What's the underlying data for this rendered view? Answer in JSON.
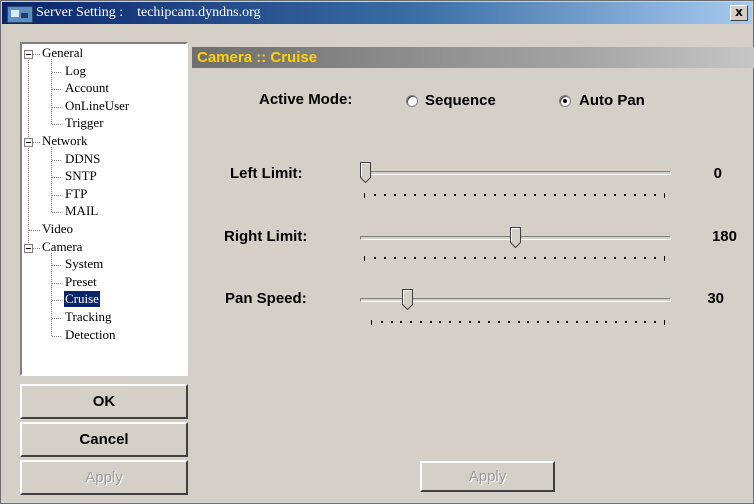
{
  "window": {
    "title_prefix": "Server Setting :",
    "title_host": "techipcam.dyndns.org",
    "close_label": "x"
  },
  "tree": {
    "nodes": [
      {
        "label": "General",
        "level": 0,
        "expander": true
      },
      {
        "label": "Log",
        "level": 1
      },
      {
        "label": "Account",
        "level": 1
      },
      {
        "label": "OnLineUser",
        "level": 1
      },
      {
        "label": "Trigger",
        "level": 1
      },
      {
        "label": "Network",
        "level": 0,
        "expander": true
      },
      {
        "label": "DDNS",
        "level": 1
      },
      {
        "label": "SNTP",
        "level": 1
      },
      {
        "label": "FTP",
        "level": 1
      },
      {
        "label": "MAIL",
        "level": 1
      },
      {
        "label": "Video",
        "level": 0
      },
      {
        "label": "Camera",
        "level": 0,
        "expander": true
      },
      {
        "label": "System",
        "level": 1
      },
      {
        "label": "Preset",
        "level": 1
      },
      {
        "label": "Cruise",
        "level": 1,
        "selected": true
      },
      {
        "label": "Tracking",
        "level": 1
      },
      {
        "label": "Detection",
        "level": 1
      }
    ]
  },
  "side_buttons": {
    "ok": "OK",
    "cancel": "Cancel",
    "apply": "Apply"
  },
  "panel": {
    "title": "Camera :: Cruise",
    "active_mode": {
      "label": "Active Mode:",
      "options": [
        "Sequence",
        "Auto Pan"
      ],
      "selected": "Auto Pan"
    },
    "sliders": [
      {
        "label": "Left Limit:",
        "value": "0",
        "fraction": 0.0
      },
      {
        "label": "Right Limit:",
        "value": "180",
        "fraction": 0.5
      },
      {
        "label": "Pan Speed:",
        "value": "30",
        "fraction": 0.14
      }
    ],
    "apply_label": "Apply"
  },
  "colors": {
    "title_bar_start": "#0a246a",
    "panel_title_text": "#ffd200",
    "selection": "#0a246a"
  }
}
